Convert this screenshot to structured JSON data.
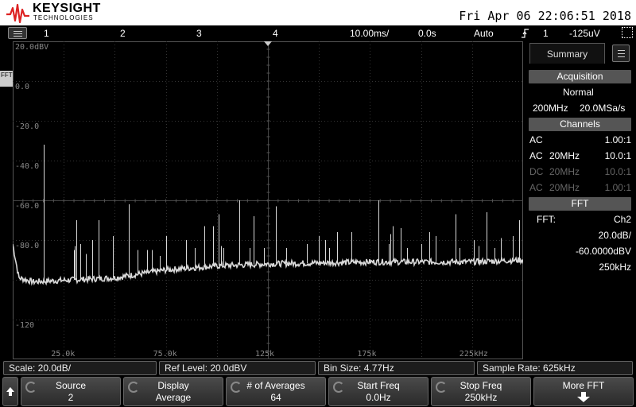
{
  "header": {
    "brand": "KEYSIGHT",
    "brand_sub": "TECHNOLOGIES",
    "datetime": "Fri Apr 06 22:06:51 2018"
  },
  "statusbar": {
    "channels": [
      "1",
      "2",
      "3",
      "4"
    ],
    "timebase": "10.00ms/",
    "delay": "0.0s",
    "trigger_mode": "Auto",
    "trigger_source": "1",
    "trigger_level": "-125uV"
  },
  "graticule": {
    "y_labels": [
      "20.0dBV",
      "0.0",
      "-20.0",
      "-40.0",
      "-60.0",
      "-80.0",
      "",
      "-120"
    ],
    "x_labels": [
      "25.0k",
      "75.0k",
      "125k",
      "175k",
      "225kHz"
    ],
    "fft_marker": "FFT",
    "trace_color": "#d8d8d8"
  },
  "panel": {
    "tab": "Summary",
    "acquisition": {
      "header": "Acquisition",
      "mode": "Normal",
      "bandwidth": "200MHz",
      "sample_rate": "20.0MSa/s"
    },
    "channels": {
      "header": "Channels",
      "rows": [
        {
          "coupling": "AC",
          "bw": "",
          "probe": "1.00:1",
          "dim": false
        },
        {
          "coupling": "AC",
          "bw": "20MHz",
          "probe": "10.0:1",
          "dim": false
        },
        {
          "coupling": "DC",
          "bw": "20MHz",
          "probe": "10.0:1",
          "dim": true
        },
        {
          "coupling": "AC",
          "bw": "20MHz",
          "probe": "1.00:1",
          "dim": true
        }
      ]
    },
    "fft": {
      "header": "FFT",
      "label": "FFT:",
      "source": "Ch2",
      "scale": "20.0dB/",
      "offset": "-60.0000dBV",
      "span": "250kHz"
    }
  },
  "infobar": {
    "scale": "Scale: 20.0dB/",
    "ref_level": "Ref Level: 20.0dBV",
    "bin_size": "Bin Size: 4.77Hz",
    "sample_rate": "Sample Rate: 625kHz"
  },
  "softkeys": [
    {
      "label": "Source",
      "value": "2"
    },
    {
      "label": "Display",
      "value": "Average"
    },
    {
      "label": "# of Averages",
      "value": "64"
    },
    {
      "label": "Start Freq",
      "value": "0.0Hz"
    },
    {
      "label": "Stop Freq",
      "value": "250kHz"
    },
    {
      "label": "More FFT",
      "value": ""
    }
  ],
  "chart_data": {
    "type": "line",
    "xlabel": "",
    "ylabel": "",
    "xlim": [
      0,
      250000
    ],
    "ylim": [
      -140,
      20
    ],
    "grid": true,
    "series": [
      {
        "noise_floor": [
          [
            0,
            -82
          ],
          [
            3000,
            -99
          ],
          [
            10000,
            -101
          ],
          [
            50000,
            -99
          ],
          [
            75000,
            -95
          ],
          [
            100000,
            -93
          ],
          [
            125000,
            -92
          ],
          [
            175000,
            -91
          ],
          [
            225000,
            -91
          ],
          [
            250000,
            -90
          ]
        ],
        "peaks": [
          [
            15000,
            -32
          ],
          [
            30000,
            -85
          ],
          [
            30500,
            -83
          ],
          [
            31000,
            -70
          ],
          [
            33000,
            -82
          ],
          [
            36000,
            -87
          ],
          [
            39000,
            -80
          ],
          [
            42000,
            -70
          ],
          [
            49000,
            -78
          ],
          [
            57000,
            -62
          ],
          [
            61000,
            -85
          ],
          [
            66000,
            -85
          ],
          [
            68000,
            -85
          ],
          [
            72000,
            -88
          ],
          [
            75000,
            -78
          ],
          [
            85000,
            -80
          ],
          [
            89000,
            -84
          ],
          [
            94000,
            -73
          ],
          [
            98000,
            -73
          ],
          [
            101000,
            -67
          ],
          [
            102000,
            -83
          ],
          [
            103000,
            -84
          ],
          [
            111000,
            -60
          ],
          [
            116000,
            -84
          ],
          [
            118000,
            -68
          ],
          [
            123000,
            -84
          ],
          [
            129000,
            -63
          ],
          [
            134000,
            -84
          ],
          [
            144000,
            -82
          ],
          [
            150000,
            -78
          ],
          [
            153000,
            -80
          ],
          [
            155000,
            -84
          ],
          [
            159000,
            -76
          ],
          [
            166000,
            -76
          ],
          [
            179000,
            -60
          ],
          [
            184000,
            -82
          ],
          [
            185000,
            -77
          ],
          [
            186000,
            -73
          ],
          [
            190000,
            -74
          ],
          [
            193000,
            -84
          ],
          [
            200000,
            -82
          ],
          [
            204000,
            -76
          ],
          [
            207000,
            -78
          ],
          [
            217000,
            -67
          ],
          [
            219000,
            -84
          ],
          [
            226000,
            -80
          ],
          [
            228000,
            -83
          ],
          [
            232000,
            -66
          ],
          [
            236000,
            -84
          ],
          [
            239000,
            -79
          ],
          [
            245000,
            -78
          ],
          [
            248000,
            -70
          ]
        ]
      }
    ]
  }
}
